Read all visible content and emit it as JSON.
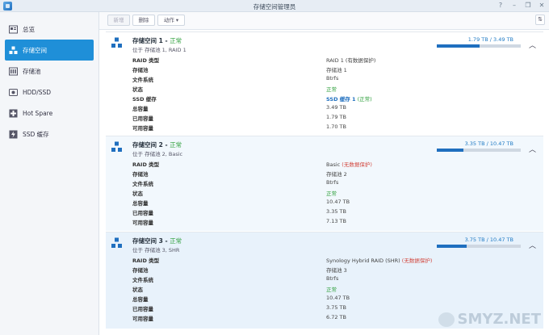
{
  "window": {
    "title": "存储空间管理员"
  },
  "sidebar": {
    "items": [
      {
        "label": "总览",
        "icon": "overview-icon"
      },
      {
        "label": "存储空间",
        "icon": "volume-icon"
      },
      {
        "label": "存储池",
        "icon": "storage-pool-icon"
      },
      {
        "label": "HDD/SSD",
        "icon": "drive-icon"
      },
      {
        "label": "Hot Spare",
        "icon": "hot-spare-icon"
      },
      {
        "label": "SSD 缓存",
        "icon": "ssd-cache-icon"
      }
    ]
  },
  "toolbar": {
    "new_label": "新增",
    "delete_label": "删除",
    "action_label": "动作 ▾"
  },
  "colors": {
    "accent": "#1f8fd8",
    "status_ok": "#2e9f3b",
    "status_warn": "#d2473e",
    "bar_fill": "#1f6fbf"
  },
  "volumes": [
    {
      "name": "存储空间 1",
      "status": "正常",
      "sub": "位于 存储池 1, RAID 1",
      "capacity": "1.79 TB / 3.49 TB",
      "usage_fraction": 0.513,
      "rows": {
        "raid_label": "RAID 类型",
        "raid_value": "RAID 1 (有数据保护)",
        "pool_label": "存储池",
        "pool_value": "存储池 1",
        "fs_label": "文件系统",
        "fs_value": "Btrfs",
        "status_label": "状态",
        "status_value": "正常",
        "ssd_label": "SSD 缓存",
        "ssd_value": "SSD 缓存 1",
        "ssd_status": "(正常)",
        "total_label": "总容量",
        "total_value": "3.49 TB",
        "used_label": "已用容量",
        "used_value": "1.79 TB",
        "avail_label": "可用容量",
        "avail_value": "1.70 TB"
      }
    },
    {
      "name": "存储空间 2",
      "status": "正常",
      "sub": "位于 存储池 2, Basic",
      "capacity": "3.35 TB / 10.47 TB",
      "usage_fraction": 0.32,
      "rows": {
        "raid_label": "RAID 类型",
        "raid_value": "Basic",
        "raid_note": "(无数据保护)",
        "pool_label": "存储池",
        "pool_value": "存储池 2",
        "fs_label": "文件系统",
        "fs_value": "Btrfs",
        "status_label": "状态",
        "status_value": "正常",
        "total_label": "总容量",
        "total_value": "10.47 TB",
        "used_label": "已用容量",
        "used_value": "3.35 TB",
        "avail_label": "可用容量",
        "avail_value": "7.13 TB"
      }
    },
    {
      "name": "存储空间 3",
      "status": "正常",
      "sub": "位于 存储池 3, SHR",
      "capacity": "3.75 TB / 10.47 TB",
      "usage_fraction": 0.358,
      "rows": {
        "raid_label": "RAID 类型",
        "raid_value": "Synology Hybrid RAID (SHR)",
        "raid_note": "(无数据保护)",
        "pool_label": "存储池",
        "pool_value": "存储池 3",
        "fs_label": "文件系统",
        "fs_value": "Btrfs",
        "status_label": "状态",
        "status_value": "正常",
        "total_label": "总容量",
        "total_value": "10.47 TB",
        "used_label": "已用容量",
        "used_value": "3.75 TB",
        "avail_label": "可用容量",
        "avail_value": "6.72 TB"
      }
    }
  ],
  "watermark": "SMYZ.NET"
}
